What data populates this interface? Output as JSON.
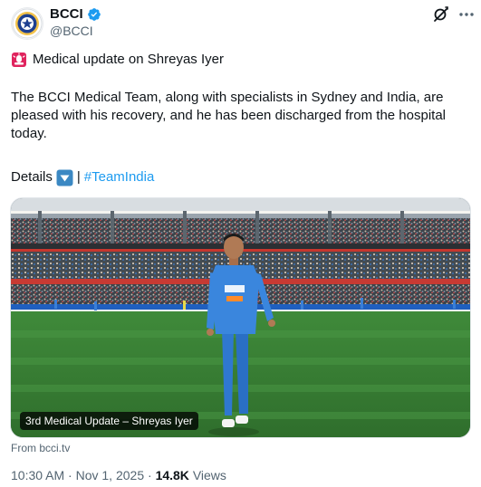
{
  "account": {
    "name": "BCCI",
    "handle": "@BCCI",
    "avatar_icon": "bcci-logo-icon",
    "verified_icon": "verified-badge-icon"
  },
  "tweet": {
    "headline_icon": "rotating-light-icon",
    "headline": "Medical update on Shreyas Iyer",
    "body": "The BCCI Medical Team, along with specialists in Sydney and India, are pleased with his recovery, and he has been discharged from the hospital today.",
    "details_label": "Details",
    "details_icon": "down-button-icon",
    "separator": "|",
    "hashtag": "#TeamIndia"
  },
  "media": {
    "caption": "3rd Medical Update – Shreyas Iyer",
    "source": "From bcci.tv"
  },
  "meta": {
    "time": "10:30 AM",
    "dot": "·",
    "date": "Nov 1, 2025",
    "views_count": "14.8K",
    "views_label": "Views"
  },
  "colors": {
    "link": "#1d9bf0",
    "muted": "#536471",
    "text": "#0f1419",
    "verified": "#1d9bf0"
  }
}
